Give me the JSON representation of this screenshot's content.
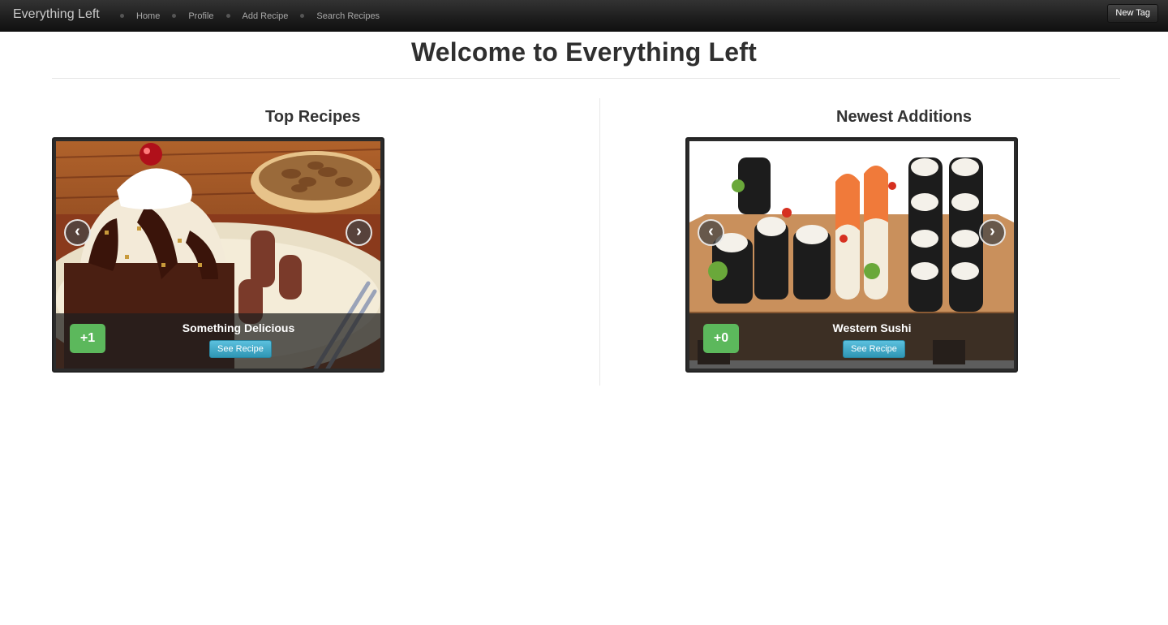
{
  "navbar": {
    "brand": "Everything Left",
    "links": [
      "Home",
      "Profile",
      "Add Recipe",
      "Search Recipes"
    ],
    "new_tag_label": "New Tag"
  },
  "page_title": "Welcome to Everything Left",
  "top_recipes": {
    "title": "Top Recipes",
    "item": {
      "name": "Something Delicious",
      "score": "+1",
      "button": "See Recipe"
    }
  },
  "newest_additions": {
    "title": "Newest Additions",
    "item": {
      "name": "Western Sushi",
      "score": "+0",
      "button": "See Recipe"
    }
  },
  "arrows": {
    "prev": "‹",
    "next": "›"
  },
  "colors": {
    "score_badge": "#5cb85c",
    "info_button": "#2f96b4",
    "navbar": "#1d1d1d"
  }
}
